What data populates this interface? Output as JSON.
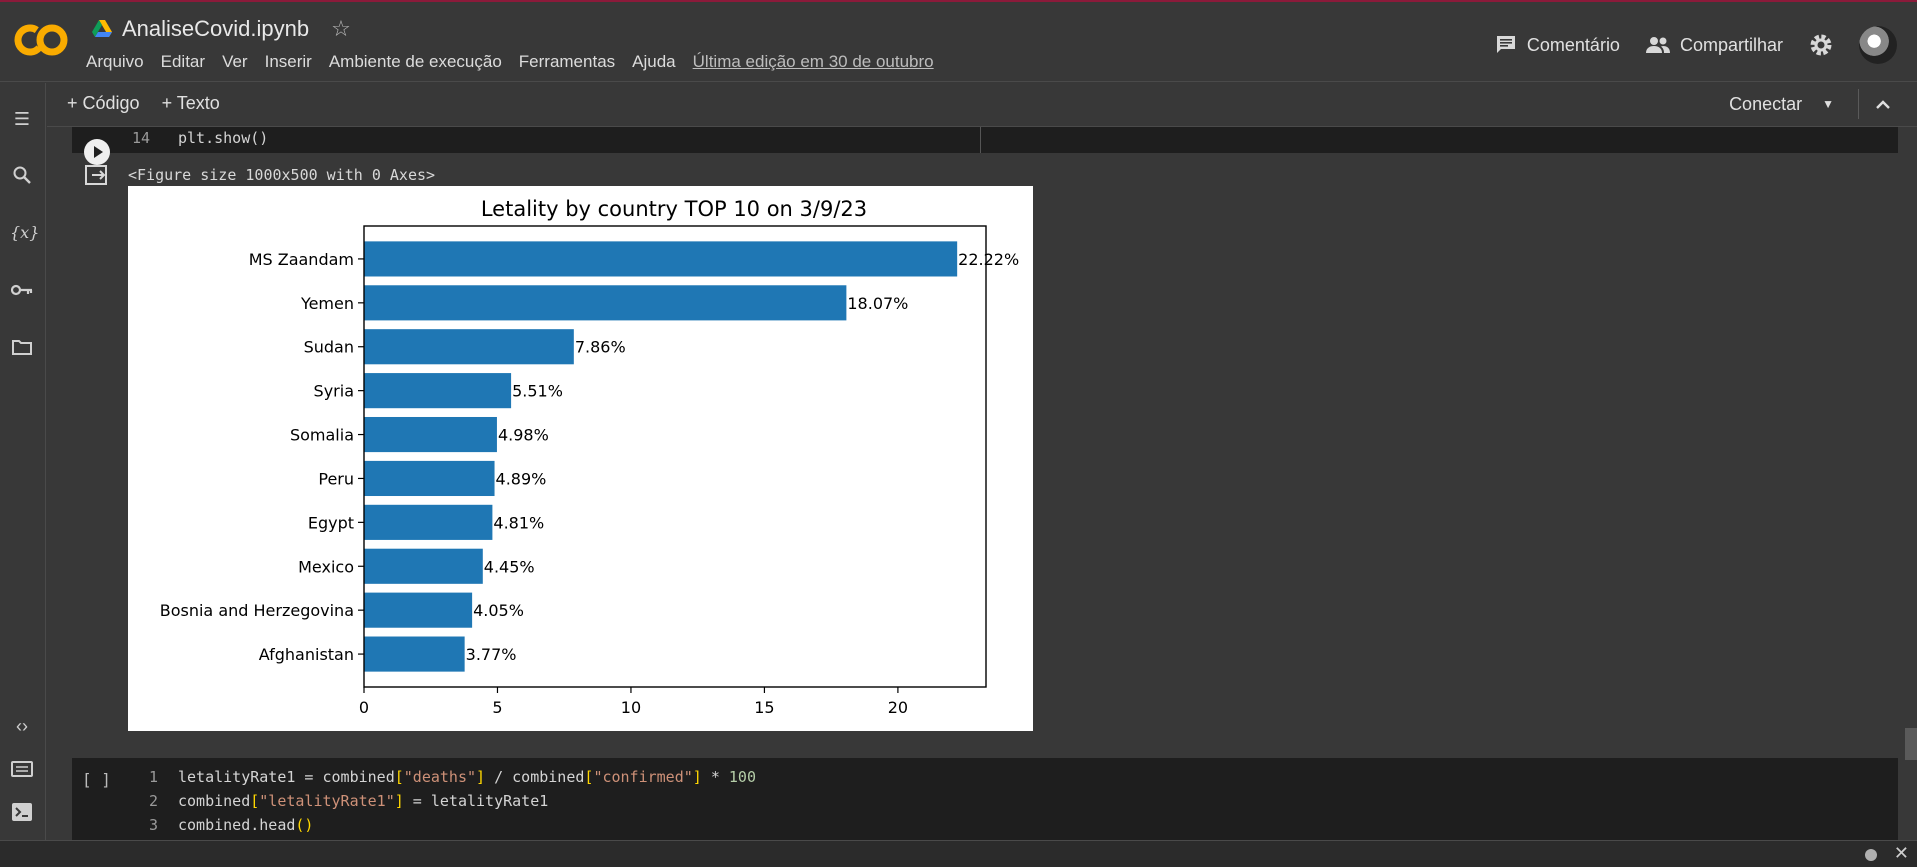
{
  "app": {
    "logo_text": "CO"
  },
  "header": {
    "title": "AnaliseCovid.ipynb",
    "menu": [
      "Arquivo",
      "Editar",
      "Ver",
      "Inserir",
      "Ambiente de execução",
      "Ferramentas",
      "Ajuda"
    ],
    "last_edit": "Última edição em 30 de outubro",
    "comment_label": "Comentário",
    "share_label": "Compartilhar"
  },
  "toolbar": {
    "add_code": "+ Código",
    "add_text": "+ Texto",
    "connect": "Conectar"
  },
  "top_cell": {
    "line_number": "14",
    "code": "plt.show()"
  },
  "output": {
    "figure_text": "<Figure size 1000x500 with 0 Axes>"
  },
  "chart_data": {
    "type": "bar",
    "orientation": "horizontal",
    "title": "Letality by country TOP 10 on 3/9/23",
    "categories": [
      "MS Zaandam",
      "Yemen",
      "Sudan",
      "Syria",
      "Somalia",
      "Peru",
      "Egypt",
      "Mexico",
      "Bosnia and Herzegovina",
      "Afghanistan"
    ],
    "values": [
      22.22,
      18.07,
      7.86,
      5.51,
      4.98,
      4.89,
      4.81,
      4.45,
      4.05,
      3.77
    ],
    "data_labels": [
      "22.22%",
      "18.07%",
      "7.86%",
      "5.51%",
      "4.98%",
      "4.89%",
      "4.81%",
      "4.45%",
      "4.05%",
      "3.77%"
    ],
    "xticks": [
      0,
      5,
      10,
      15,
      20
    ],
    "xlim": [
      0,
      23.3
    ],
    "bar_color": "#1f77b4"
  },
  "bottom_cell": {
    "bracket": "[ ]",
    "lines": [
      {
        "n": "1",
        "parts": [
          "letalityRate1 = combined",
          "[",
          "\"deaths\"",
          "]",
          " / combined",
          "[",
          "\"confirmed\"",
          "]",
          " * ",
          "100"
        ]
      },
      {
        "n": "2",
        "parts": [
          "combined",
          "[",
          "\"letalityRate1\"",
          "]",
          " = letalityRate1"
        ]
      },
      {
        "n": "3",
        "parts": [
          "combined.head",
          "()"
        ]
      }
    ]
  },
  "colors": {
    "background": "#383838",
    "cell_bg": "#1e1e1e",
    "logo_orange": "#f9ab00"
  }
}
